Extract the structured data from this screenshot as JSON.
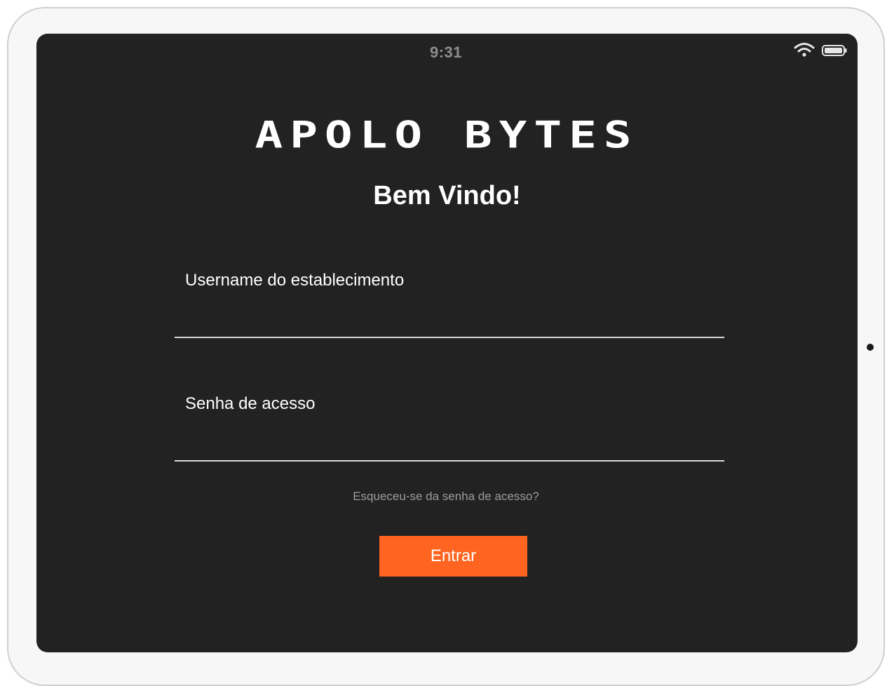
{
  "status_bar": {
    "time": "9:31",
    "wifi_icon": "wifi-icon",
    "battery_icon": "battery-icon"
  },
  "brand": {
    "logo_text": "APOLO BYTES"
  },
  "login": {
    "title": "Bem Vindo!",
    "username": {
      "label": "Username do establecimento",
      "value": ""
    },
    "password": {
      "label": "Senha de acesso",
      "value": ""
    },
    "forgot_link": "Esqueceu-se da senha de acesso?",
    "submit_label": "Entrar"
  },
  "colors": {
    "background": "#222222",
    "accent": "#ff6420",
    "text": "#ffffff",
    "muted": "#9b9b9b"
  }
}
